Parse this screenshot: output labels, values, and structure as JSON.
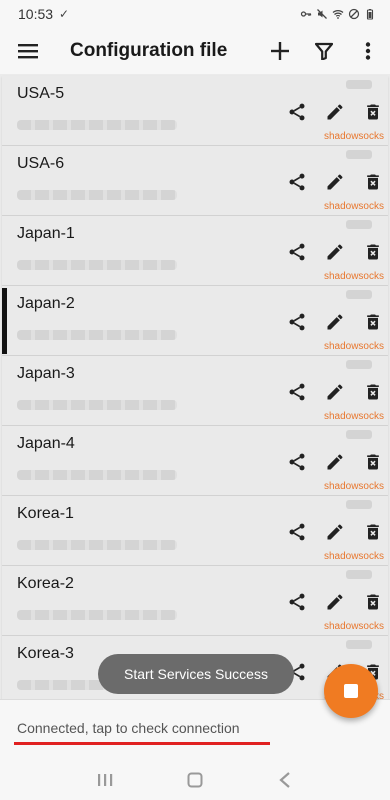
{
  "status_bar": {
    "time": "10:53",
    "icons": [
      "key-icon",
      "mute-icon",
      "wifi-icon",
      "dnd-icon",
      "battery-icon"
    ]
  },
  "app_bar": {
    "title": "Configuration file",
    "actions": [
      "add-icon",
      "filter-icon",
      "more-vert-icon"
    ]
  },
  "colors": {
    "accent": "#f07b22",
    "protocol": "#e8772e",
    "underline": "#e02020"
  },
  "servers": [
    {
      "name": "USA-5",
      "protocol": "shadowsocks",
      "active": false
    },
    {
      "name": "USA-6",
      "protocol": "shadowsocks",
      "active": false
    },
    {
      "name": "Japan-1",
      "protocol": "shadowsocks",
      "active": false
    },
    {
      "name": "Japan-2",
      "protocol": "shadowsocks",
      "active": true
    },
    {
      "name": "Japan-3",
      "protocol": "shadowsocks",
      "active": false
    },
    {
      "name": "Japan-4",
      "protocol": "shadowsocks",
      "active": false
    },
    {
      "name": "Korea-1",
      "protocol": "shadowsocks",
      "active": false
    },
    {
      "name": "Korea-2",
      "protocol": "shadowsocks",
      "active": false
    },
    {
      "name": "Korea-3",
      "protocol": "shadowsocks",
      "active": false
    }
  ],
  "toast": "Start Services Success",
  "bottom": {
    "status_text": "Connected, tap to check connection"
  }
}
